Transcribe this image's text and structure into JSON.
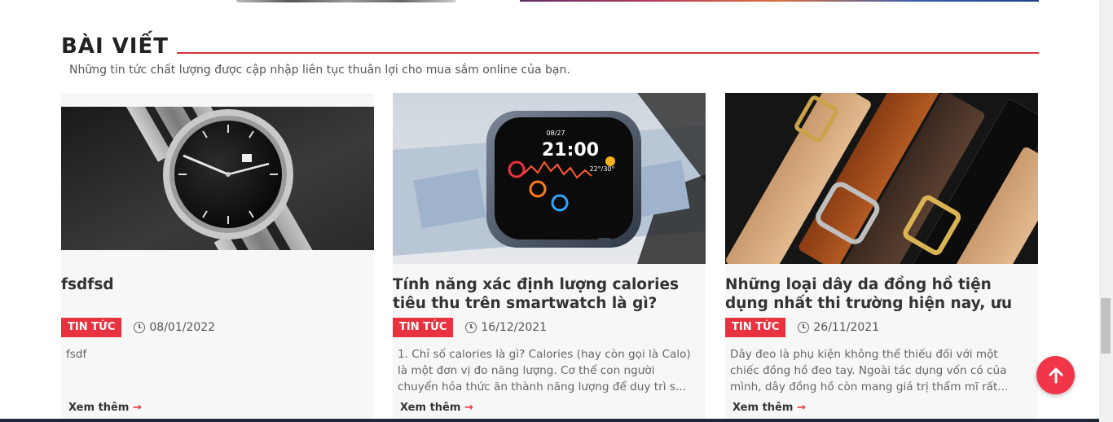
{
  "section": {
    "title": "BÀI VIẾT",
    "subtitle": "Những tin tức chất lượng được cập nhập liên tục thuân lợi cho mua sắm online của bạn."
  },
  "accent_color": "#e8323f",
  "posts": [
    {
      "image": "luxury-watch-black-dial-photo",
      "title": "fsdfsd",
      "category": "TIN TỨC",
      "date": "08/01/2022",
      "excerpt": "fsdf",
      "read_more": "Xem thêm",
      "read_more_arrow": "→"
    },
    {
      "image": "smartwatch-photo",
      "title": "Tính năng xác định lượng calories tiêu thu trên smartwatch là gì?",
      "category": "TIN TỨC",
      "date": "16/12/2021",
      "excerpt": "1. Chỉ số calories là gì? Calories (hay còn gọi là Calo) là một đơn vị đo năng lượng. Cơ thể con người chuyển hóa thức ăn thành năng lượng để duy trì s...",
      "read_more": "Xem thêm",
      "read_more_arrow": "→"
    },
    {
      "image": "leather-watch-straps-photo",
      "title": "Những loại dây da đồng hồ tiện dụng nhất thi trường hiện nay, ưu nhược...",
      "category": "TIN TỨC",
      "date": "26/11/2021",
      "excerpt": "Dây đeo là phụ kiện không thể thiếu đối với một chiếc đồng hồ đeo tay. Ngoài tác dụng vốn có của mình, dây đồng hồ còn mang giá trị thẩm mĩ rất...",
      "read_more": "Xem thêm",
      "read_more_arrow": "→"
    }
  ],
  "smartwatch_screen": {
    "time": "21:00",
    "date": "08/27",
    "temp": "22°/30°"
  },
  "scroll_top_icon": "arrow-up-icon"
}
